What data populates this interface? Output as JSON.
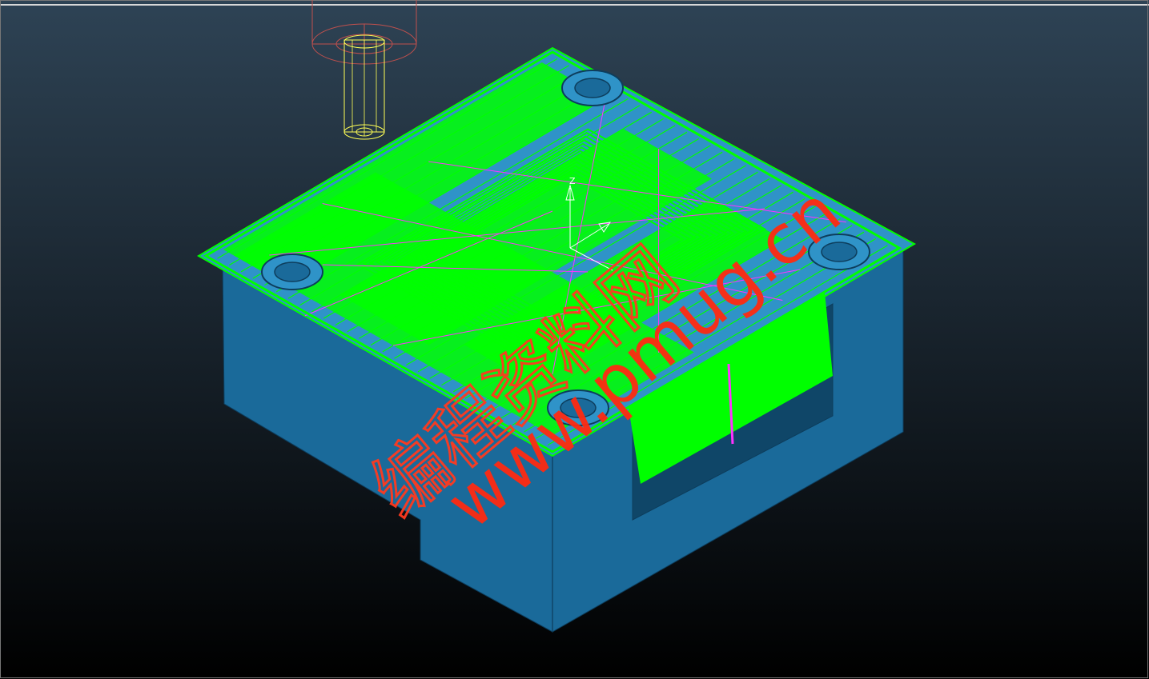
{
  "viewport": {
    "bg_top": "#2e4355",
    "bg_bottom": "#000000",
    "frame_color": "#d8d8d8"
  },
  "colors": {
    "part_body": "#1a6a9a",
    "part_side_dark": "#154f75",
    "part_top": "#2f93c8",
    "toolpath_primary": "#00ff00",
    "toolpath_secondary": "#ff33ff",
    "tool_holder": "#c0504d",
    "tool_cutter": "#ffff55",
    "axis_triad": "#ffffff",
    "watermark": "#ff3a1f"
  },
  "icons": {
    "tool": "cutter-tool-icon",
    "triad": "xyz-axis-triad-icon"
  },
  "triad": {
    "z_label": "Z"
  },
  "watermark": {
    "chinese": "编程资料网",
    "url": "www.pmug.cn"
  }
}
